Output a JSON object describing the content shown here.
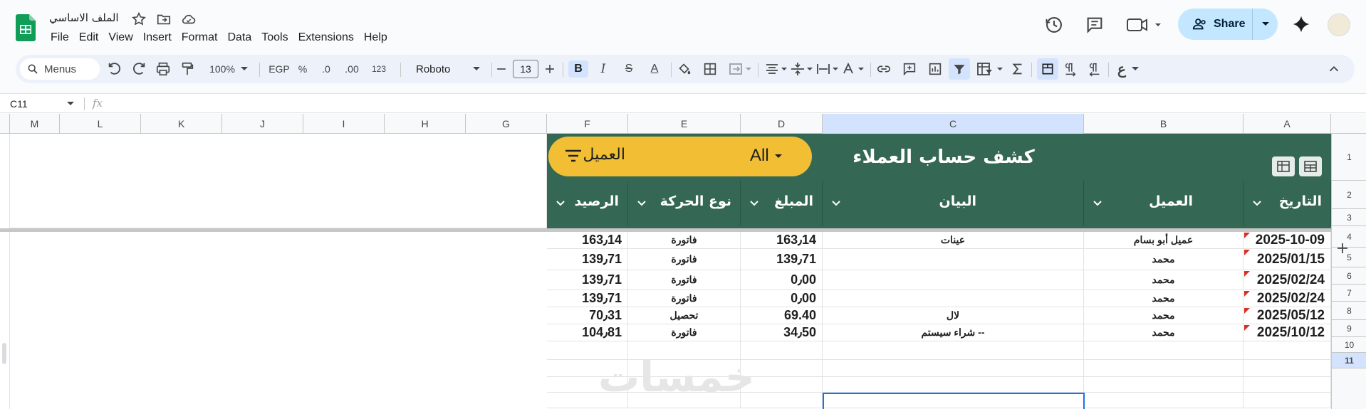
{
  "app": {
    "doc_title": "الملف الاساسي",
    "menu": [
      "File",
      "Edit",
      "View",
      "Insert",
      "Format",
      "Data",
      "Tools",
      "Extensions",
      "Help"
    ],
    "share_label": "Share"
  },
  "toolbar": {
    "menus_label": "Menus",
    "zoom": "100%",
    "currency": "EGP",
    "percent": "%",
    "dec_less": ".0",
    "dec_more": ".00",
    "number_format": "123",
    "font": "Roboto",
    "font_size": "13",
    "bold": "B",
    "italic": "I",
    "strike": "S",
    "text_color": "A"
  },
  "formula_bar": {
    "cell_ref": "C11",
    "fx": "fx"
  },
  "columns": [
    "M",
    "L",
    "K",
    "J",
    "I",
    "H",
    "G",
    "F",
    "E",
    "D",
    "C",
    "B",
    "A"
  ],
  "rows": [
    "1",
    "2",
    "3",
    "4",
    "5",
    "6",
    "7",
    "8",
    "9",
    "10",
    "11"
  ],
  "sheet": {
    "title": "كشف حساب العملاء",
    "filter_label": "العميل",
    "filter_value": "All",
    "headers": {
      "date": "التاريخ",
      "client": "العميل",
      "statement": "البيان",
      "amount": "المبلغ",
      "type": "نوع الحركة",
      "balance": "الرصيد"
    },
    "records": [
      {
        "date": "2025-10-09",
        "client": "عميل أبو بسام",
        "statement": "عينات",
        "amount": "163٫14",
        "type": "فاتورة",
        "balance": "163٫14"
      },
      {
        "date": "2025/01/15",
        "client": "محمد",
        "statement": "",
        "amount": "139٫71",
        "type": "فاتورة",
        "balance": "139٫71"
      },
      {
        "date": "2025/02/24",
        "client": "محمد",
        "statement": "",
        "amount": "0٫00",
        "type": "فاتورة",
        "balance": "139٫71"
      },
      {
        "date": "2025/02/24",
        "client": "محمد",
        "statement": "",
        "amount": "0٫00",
        "type": "فاتورة",
        "balance": "139٫71"
      },
      {
        "date": "2025/05/12",
        "client": "محمد",
        "statement": "لال",
        "amount": "69.40",
        "type": "تحصيل",
        "balance": "70٫31"
      },
      {
        "date": "2025/10/12",
        "client": "محمد",
        "statement": "-- شراء سيستم",
        "amount": "34٫50",
        "type": "فاتورة",
        "balance": "104٫81"
      }
    ]
  },
  "watermark": "خمسات",
  "colors": {
    "header_green": "#356854",
    "chip_yellow": "#f1be34",
    "share_blue": "#c2e7ff",
    "selection": "#1a73e8"
  }
}
